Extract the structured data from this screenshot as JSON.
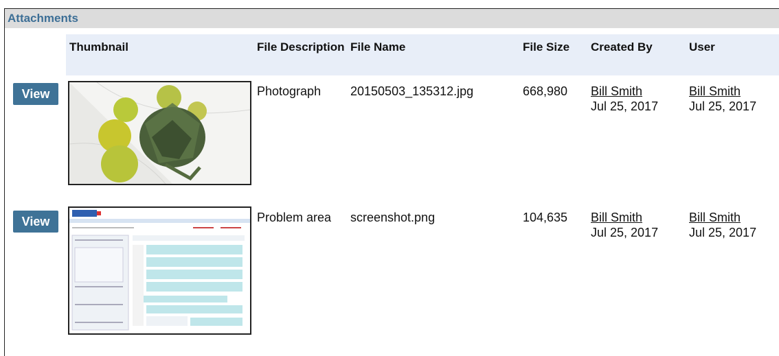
{
  "section": {
    "title": "Attachments"
  },
  "columns": {
    "thumbnail": "Thumbnail",
    "file_description": "File Description",
    "file_name": "File Name",
    "file_size": "File Size",
    "created_by": "Created By",
    "user": "User"
  },
  "rows": [
    {
      "view_label": "View",
      "thumbnail": "photo-artichoke-lemons",
      "file_description": "Photograph",
      "file_name": "20150503_135312.jpg",
      "file_size": "668,980",
      "created_by": {
        "name": "Bill Smith",
        "date": "Jul 25, 2017"
      },
      "user": {
        "name": "Bill Smith",
        "date": "Jul 25, 2017"
      }
    },
    {
      "view_label": "View",
      "thumbnail": "screenshot-web-app",
      "file_description": "Problem area",
      "file_name": "screenshot.png",
      "file_size": "104,635",
      "created_by": {
        "name": "Bill Smith",
        "date": "Jul 25, 2017"
      },
      "user": {
        "name": "Bill Smith",
        "date": "Jul 25, 2017"
      }
    }
  ]
}
